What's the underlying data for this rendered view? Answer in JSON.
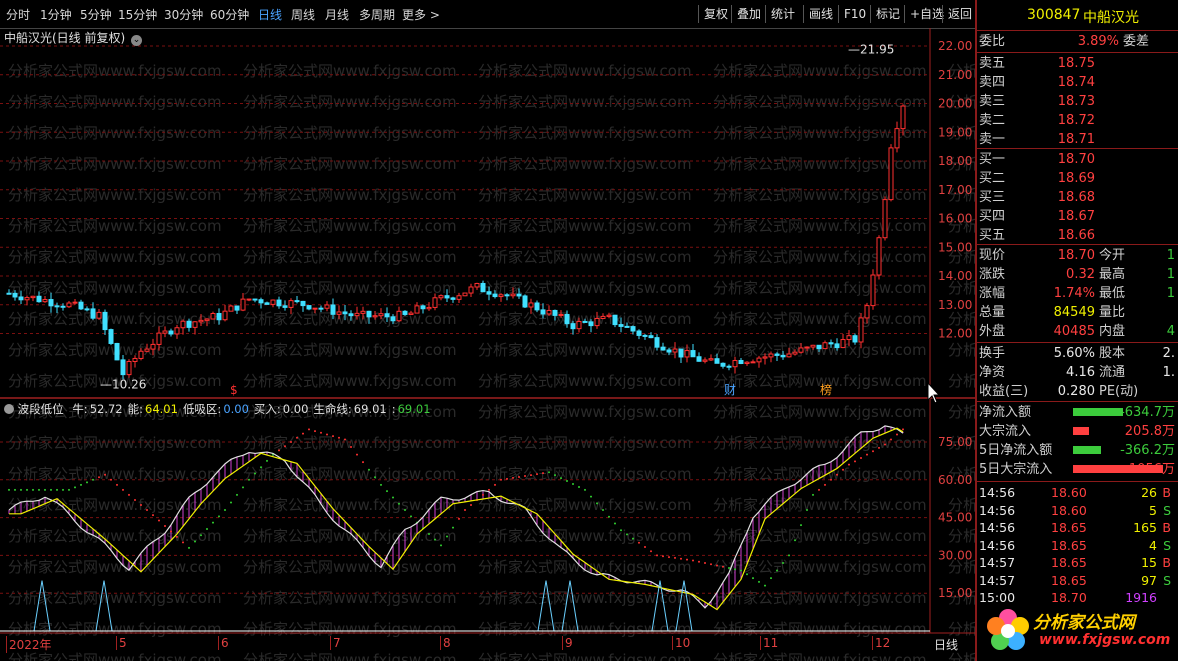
{
  "toolbar": {
    "periods": [
      {
        "label": "分时",
        "active": false
      },
      {
        "label": "1分钟",
        "active": false
      },
      {
        "label": "5分钟",
        "active": false
      },
      {
        "label": "15分钟",
        "active": false
      },
      {
        "label": "30分钟",
        "active": false
      },
      {
        "label": "60分钟",
        "active": false
      },
      {
        "label": "日线",
        "active": true
      },
      {
        "label": "周线",
        "active": false
      },
      {
        "label": "月线",
        "active": false
      },
      {
        "label": "多周期",
        "active": false
      },
      {
        "label": "更多 >",
        "active": false
      }
    ],
    "right_buttons": [
      "复权",
      "叠加",
      "统计",
      "画线",
      "F10",
      "标记",
      "+自选",
      "返回"
    ]
  },
  "watermark_text": "分析家公式网www.fxjgsw.com",
  "main_pane": {
    "title": "中船汉光(日线 前复权)",
    "high_label": "21.95",
    "low_label": "10.26",
    "event_markers": [
      {
        "text": "$",
        "color": "#ff3030"
      },
      {
        "text": "财",
        "color": "#4aa3ff"
      },
      {
        "text": "榜",
        "color": "#ffa020"
      }
    ],
    "price_axis": [
      "22.00",
      "21.00",
      "20.00",
      "19.00",
      "18.00",
      "17.00",
      "16.00",
      "15.00",
      "14.00",
      "13.00",
      "12.00"
    ]
  },
  "indicator_pane": {
    "name": "波段低位",
    "items": [
      {
        "label": "牛:",
        "value": "52.72",
        "color": "#e0e0e0"
      },
      {
        "label": "能:",
        "value": "64.01",
        "color": "#f0f000"
      },
      {
        "label": "低吸区:",
        "value": "0.00",
        "color": "#4aa3ff"
      },
      {
        "label": "买入:",
        "value": "0.00",
        "color": "#e0e0e0"
      },
      {
        "label": "生命线:",
        "value": "69.01",
        "color": "#e0e0e0"
      },
      {
        "label": ":",
        "value": "69.01",
        "color": "#3ccc3c"
      }
    ],
    "axis": [
      "75.00",
      "60.00",
      "45.00",
      "30.00",
      "15.00"
    ]
  },
  "x_axis": {
    "labels": [
      "2022年",
      "5",
      "6",
      "7",
      "8",
      "9",
      "10",
      "11",
      "12"
    ],
    "period_label": "日线"
  },
  "quote_panel": {
    "code": "300847",
    "name": "中船汉光",
    "weibi_label": "委比",
    "weibi_value": "3.89%",
    "weicha_label": "委差",
    "asks": [
      {
        "label": "卖五",
        "price": "18.75"
      },
      {
        "label": "卖四",
        "price": "18.74"
      },
      {
        "label": "卖三",
        "price": "18.73"
      },
      {
        "label": "卖二",
        "price": "18.72"
      },
      {
        "label": "卖一",
        "price": "18.71"
      }
    ],
    "bids": [
      {
        "label": "买一",
        "price": "18.70"
      },
      {
        "label": "买二",
        "price": "18.69"
      },
      {
        "label": "买三",
        "price": "18.68"
      },
      {
        "label": "买四",
        "price": "18.67"
      },
      {
        "label": "买五",
        "price": "18.66"
      }
    ],
    "stats": [
      {
        "l1": "现价",
        "v1": "18.70",
        "c1": "red",
        "l2": "今开",
        "v2": "1"
      },
      {
        "l1": "涨跌",
        "v1": "0.32",
        "c1": "red",
        "l2": "最高",
        "v2": "1"
      },
      {
        "l1": "涨幅",
        "v1": "1.74%",
        "c1": "red",
        "l2": "最低",
        "v2": "1"
      },
      {
        "l1": "总量",
        "v1": "84549",
        "c1": "yellow",
        "l2": "量比",
        "v2": ""
      },
      {
        "l1": "外盘",
        "v1": "40485",
        "c1": "red",
        "l2": "内盘",
        "v2": "4"
      }
    ],
    "stats2": [
      {
        "l1": "换手",
        "v1": "5.60%",
        "l2": "股本",
        "v2": "2."
      },
      {
        "l1": "净资",
        "v1": "4.16",
        "l2": "流通",
        "v2": "1."
      },
      {
        "l1": "收益(三)",
        "v1": "0.280",
        "l2": "PE(动)",
        "v2": ""
      }
    ],
    "flows": [
      {
        "label": "净流入额",
        "value": "-634.7万",
        "color": "#3ccc3c",
        "bar": 0.25
      },
      {
        "label": "大宗流入",
        "value": "205.8万",
        "color": "#ff4040",
        "bar": 0.08
      },
      {
        "label": "5日净流入额",
        "value": "-366.2万",
        "color": "#3ccc3c",
        "bar": 0.14
      },
      {
        "label": "5日大宗流入",
        "value": "1056万",
        "color": "#ff4040",
        "bar": 0.45
      }
    ],
    "ticks": [
      {
        "time": "14:56",
        "price": "18.60",
        "vol": "26",
        "side": "B"
      },
      {
        "time": "14:56",
        "price": "18.60",
        "vol": "5",
        "side": "S"
      },
      {
        "time": "14:56",
        "price": "18.65",
        "vol": "165",
        "side": "B"
      },
      {
        "time": "14:56",
        "price": "18.65",
        "vol": "4",
        "side": "S"
      },
      {
        "time": "14:57",
        "price": "18.65",
        "vol": "15",
        "side": "B"
      },
      {
        "time": "14:57",
        "price": "18.65",
        "vol": "97",
        "side": "S"
      },
      {
        "time": "15:00",
        "price": "18.70",
        "vol": "1916",
        "side": ""
      }
    ],
    "logo_text": "分析家公式网",
    "logo_url": "www.fxjgsw.com"
  }
}
